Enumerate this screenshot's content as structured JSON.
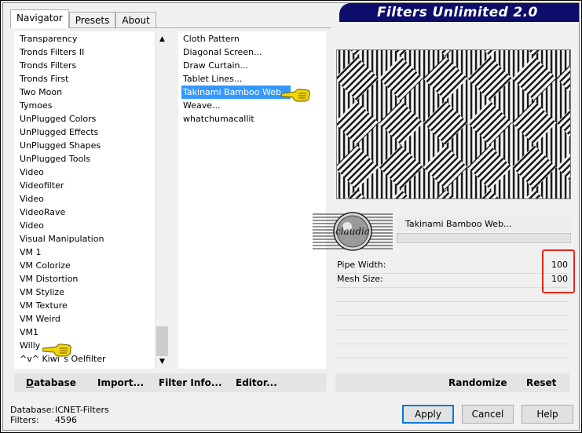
{
  "window": {
    "title": "Filters Unlimited 2.0"
  },
  "tabs": [
    {
      "label": "Navigator",
      "active": true
    },
    {
      "label": "Presets",
      "active": false
    },
    {
      "label": "About",
      "active": false
    }
  ],
  "categories": {
    "items": [
      "Transparency",
      "Tronds Filters II",
      "Tronds Filters",
      "Tronds First",
      "Two Moon",
      "Tymoes",
      "UnPlugged Colors",
      "UnPlugged Effects",
      "UnPlugged Shapes",
      "UnPlugged Tools",
      "Video",
      "Videofilter",
      "Video",
      "VideoRave",
      "Video",
      "Visual Manipulation",
      "VM 1",
      "VM Colorize",
      "VM Distortion",
      "VM Stylize",
      "VM Texture",
      "VM Weird",
      "VM1",
      "Willy",
      "^v^ Kiwi`s Oelfilter"
    ],
    "pointer_item": "Willy"
  },
  "filters": {
    "items": [
      "Cloth Pattern",
      "Diagonal Screen...",
      "Draw Curtain...",
      "Tablet Lines...",
      "Takinami Bamboo Web...",
      "Weave...",
      "whatchumacallit"
    ],
    "selected": "Takinami Bamboo Web..."
  },
  "preview": {
    "filter_name": "Takinami Bamboo Web..."
  },
  "logo": {
    "text": "claudia"
  },
  "params": [
    {
      "label": "Pipe Width:",
      "value": "100"
    },
    {
      "label": "Mesh Size:",
      "value": "100"
    }
  ],
  "toolbar": {
    "database_u": "D",
    "database_rest": "atabase",
    "import_label": "Import...",
    "import_u_index": 3,
    "filterinfo_label": "Filter Info...",
    "editor_label": "Editor...",
    "randomize_label": "Randomize",
    "reset_label": "Reset"
  },
  "status": {
    "database_label": "Database:",
    "database_value": "ICNET-Filters",
    "filters_label": "Filters:",
    "filters_value": "4596"
  },
  "buttons": {
    "apply": "Apply",
    "cancel": "Cancel",
    "help": "Help"
  },
  "colors": {
    "banner_bg": "#0d0d6a",
    "selection": "#3399ff",
    "highlight_box": "#e8261a",
    "pointer_hand": "#f2d600"
  }
}
